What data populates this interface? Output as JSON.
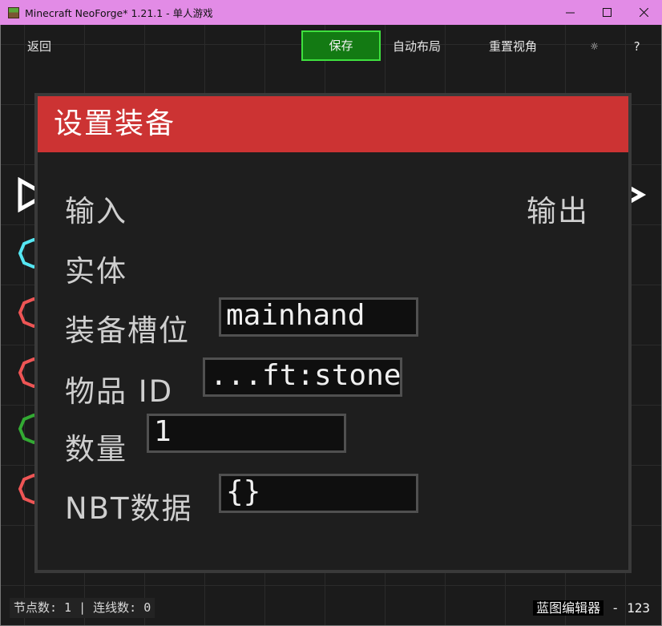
{
  "window": {
    "title": "Minecraft NeoForge* 1.21.1 - 单人游戏",
    "minimize_glyph": "—",
    "maximize_glyph": "☐",
    "close_glyph": "✕"
  },
  "toolbar": {
    "back_label": "返回",
    "save_label": "保存",
    "auto_layout_label": "自动布局",
    "reset_view_label": "重置视角",
    "settings_glyph": "☼",
    "help_glyph": "?"
  },
  "node": {
    "title": "设置装备",
    "header_color": "#cc3333",
    "exec_in_label": "输入",
    "exec_out_label": "输出",
    "pins": [
      {
        "label": "实体",
        "color": "#55e6f2"
      },
      {
        "label": "装备槽位",
        "value": "mainhand",
        "color": "#ee5555"
      },
      {
        "label": "物品 ID",
        "value": "...ft:stone",
        "color": "#ee5555"
      },
      {
        "label": "数量",
        "value": "1",
        "color": "#33aa33"
      },
      {
        "label": "NBT数据",
        "value": "{}",
        "color": "#ee5555"
      }
    ]
  },
  "status": {
    "left": "节点数: 1 | 连线数: 0",
    "editor_name": "蓝图编辑器",
    "version": "- 123"
  }
}
